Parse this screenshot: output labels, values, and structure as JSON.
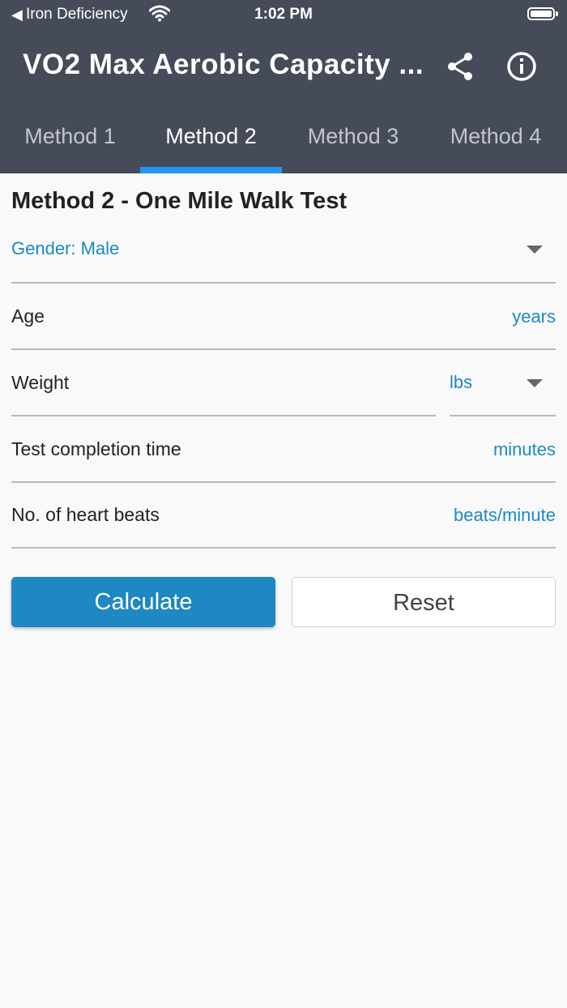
{
  "status_bar": {
    "back_glyph": "◀",
    "carrier": "Iron Deficiency",
    "time": "1:02 PM"
  },
  "header": {
    "title": "VO2 Max Aerobic Capacity ...",
    "share_icon": "share-icon",
    "info_icon": "info-icon"
  },
  "tabs": [
    {
      "label": "Method 1"
    },
    {
      "label": "Method 2",
      "active": true
    },
    {
      "label": "Method 3"
    },
    {
      "label": "Method 4"
    }
  ],
  "form": {
    "title": "Method 2 - One Mile Walk Test",
    "gender": "Gender: Male",
    "age_label": "Age",
    "age_unit": "years",
    "weight_label": "Weight",
    "weight_unit": "lbs",
    "time_label": "Test completion time",
    "time_unit": "minutes",
    "beats_label": "No. of heart beats",
    "beats_unit": "beats/minute"
  },
  "buttons": {
    "calculate": "Calculate",
    "reset": "Reset"
  },
  "colors": {
    "appbar": "#454b59",
    "accent": "#1e88c2",
    "tab_indicator": "#2196f3"
  }
}
